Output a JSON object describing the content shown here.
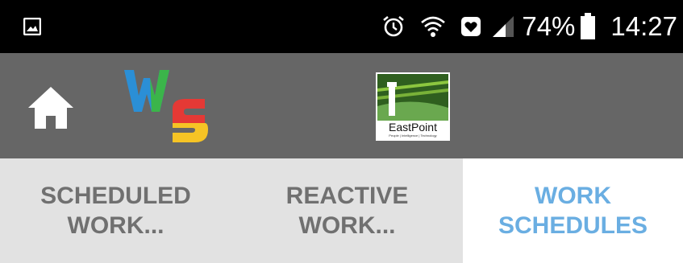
{
  "status_bar": {
    "battery_percent": "74%",
    "time": "14:27",
    "icons": [
      "gallery-icon",
      "alarm-icon",
      "wifi-icon",
      "notification-icon",
      "signal-icon",
      "battery-icon"
    ]
  },
  "app_bar": {
    "home_icon": "home-icon",
    "app_logo_text": "WS",
    "partner_logo_text": "EastPoint",
    "partner_logo_tagline": "People | Intelligence | Technology"
  },
  "tabs": [
    {
      "label": "SCHEDULED\nWORK...",
      "selected": false
    },
    {
      "label": "REACTIVE\nWORK...",
      "selected": false
    },
    {
      "label": "WORK\nSCHEDULES",
      "selected": true
    }
  ],
  "colors": {
    "status_bar": "#000000",
    "app_bar": "#666666",
    "tab_bg": "#e2e2e2",
    "tab_selected_bg": "#ffffff",
    "tab_text": "#707070",
    "tab_selected_text": "#6aaee2",
    "logo_w_blue": "#2b8fd6",
    "logo_w_green": "#3bb54a",
    "logo_s_red": "#e53935",
    "logo_s_yellow": "#f6c425"
  }
}
